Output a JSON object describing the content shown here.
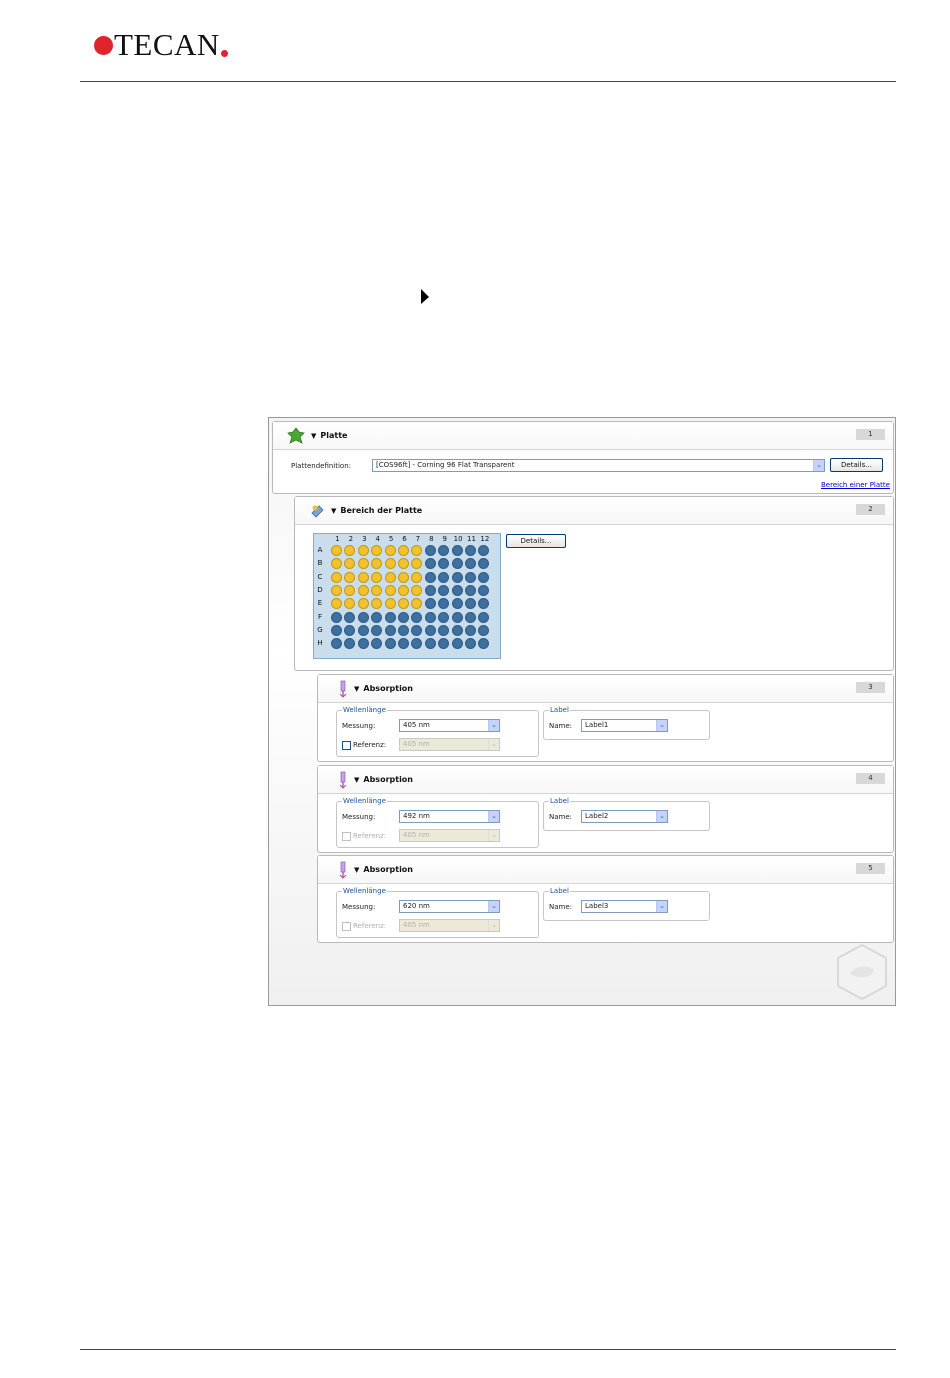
{
  "logo": {
    "text": "TECAN"
  },
  "screen": {
    "plate_panel": {
      "title": "Platte",
      "number": "1",
      "definition_label": "Plattendefinition:",
      "definition_value": "[COS96ft] - Corning 96 Flat Transparent",
      "details_button": "Details...",
      "link": "Bereich einer Platte"
    },
    "range_panel": {
      "title": "Bereich der Platte",
      "number": "2",
      "details_button": "Details...",
      "columns": [
        "1",
        "2",
        "3",
        "4",
        "5",
        "6",
        "7",
        "8",
        "9",
        "10",
        "11",
        "12"
      ],
      "rows": [
        "A",
        "B",
        "C",
        "D",
        "E",
        "F",
        "G",
        "H"
      ],
      "selected_rows": [
        "A",
        "B",
        "C",
        "D",
        "E"
      ],
      "selected_columns": [
        "1",
        "2",
        "3",
        "4",
        "5",
        "6",
        "7"
      ],
      "colors": {
        "selected": "#f2c12e",
        "unselected": "#3d6f9f",
        "plate_bg": "#c9ddec"
      }
    },
    "absorption_panels": [
      {
        "title": "Absorption",
        "number": "3",
        "group_wavelength": "Wellenlänge",
        "measurement_label": "Messung:",
        "measurement_value": "405 nm",
        "reference_label": "Referenz:",
        "reference_value": "405 nm",
        "group_label": "Label",
        "name_label": "Name:",
        "name_value": "Label1"
      },
      {
        "title": "Absorption",
        "number": "4",
        "group_wavelength": "Wellenlänge",
        "measurement_label": "Messung:",
        "measurement_value": "492 nm",
        "reference_label": "Referenz:",
        "reference_value": "405 nm",
        "group_label": "Label",
        "name_label": "Name:",
        "name_value": "Label2"
      },
      {
        "title": "Absorption",
        "number": "5",
        "group_wavelength": "Wellenlänge",
        "measurement_label": "Messung:",
        "measurement_value": "620 nm",
        "reference_label": "Referenz:",
        "reference_value": "405 nm",
        "group_label": "Label",
        "name_label": "Name:",
        "name_value": "Label3"
      }
    ]
  }
}
